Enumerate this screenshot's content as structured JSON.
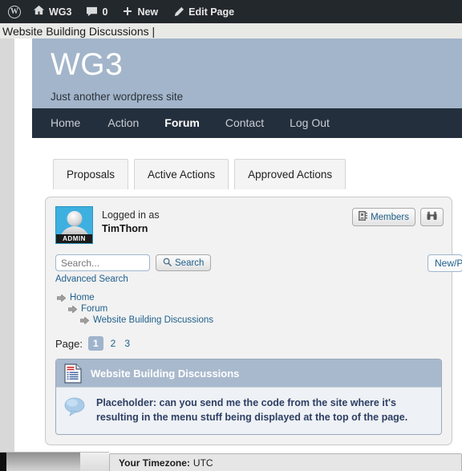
{
  "adminbar": {
    "items": [
      {
        "icon": "wordpress-logo-icon",
        "label": ""
      },
      {
        "icon": "home-icon",
        "label": "WG3"
      },
      {
        "icon": "comment-icon",
        "label": "0"
      },
      {
        "icon": "plus-icon",
        "label": "New"
      },
      {
        "icon": "pencil-icon",
        "label": "Edit Page"
      }
    ]
  },
  "browser": {
    "page_title": "Website Building Discussions |"
  },
  "site": {
    "title": "WG3",
    "tagline": "Just another wordpress site",
    "nav": [
      {
        "label": "Home",
        "active": false
      },
      {
        "label": "Action",
        "active": false
      },
      {
        "label": "Forum",
        "active": true
      },
      {
        "label": "Contact",
        "active": false
      },
      {
        "label": "Log Out",
        "active": false
      }
    ]
  },
  "tabs": [
    {
      "label": "Proposals"
    },
    {
      "label": "Active Actions"
    },
    {
      "label": "Approved Actions"
    }
  ],
  "forum": {
    "login": {
      "line1": "Logged in as",
      "username": "TimThorn",
      "avatar_badge": "ADMIN"
    },
    "header_buttons": [
      {
        "label": "Members",
        "icon": "address-book-icon"
      },
      {
        "label": "",
        "icon": "binoculars-icon"
      }
    ],
    "search": {
      "placeholder": "Search...",
      "value": "",
      "button_label": "Search",
      "button_icon": "magnifier-icon",
      "advanced_label": "Advanced Search",
      "new_post_label": "New/P"
    },
    "breadcrumb": [
      {
        "label": "Home"
      },
      {
        "label": "Forum"
      },
      {
        "label": "Website Building Discussions"
      }
    ],
    "pagination": {
      "label": "Page:",
      "pages": [
        "1",
        "2",
        "3"
      ],
      "current": "1"
    },
    "topic": {
      "title": "Website Building Discussions",
      "icon": "document-list-icon",
      "post_icon": "speech-bubble-icon",
      "post_text": "Placeholder: can you send me the code from the site where it's resulting in the menu stuff being displayed at the top of the page."
    }
  },
  "bottom_window": {
    "timezone_label": "Your Timezone:",
    "timezone_value": "UTC"
  },
  "colors": {
    "adminbar_bg": "#23282d",
    "header_bg": "#a3b5ca",
    "nav_bg": "#242f3d",
    "topic_head_bg": "#a9b9cd",
    "link": "#21618c",
    "post_text": "#2d3f63"
  }
}
